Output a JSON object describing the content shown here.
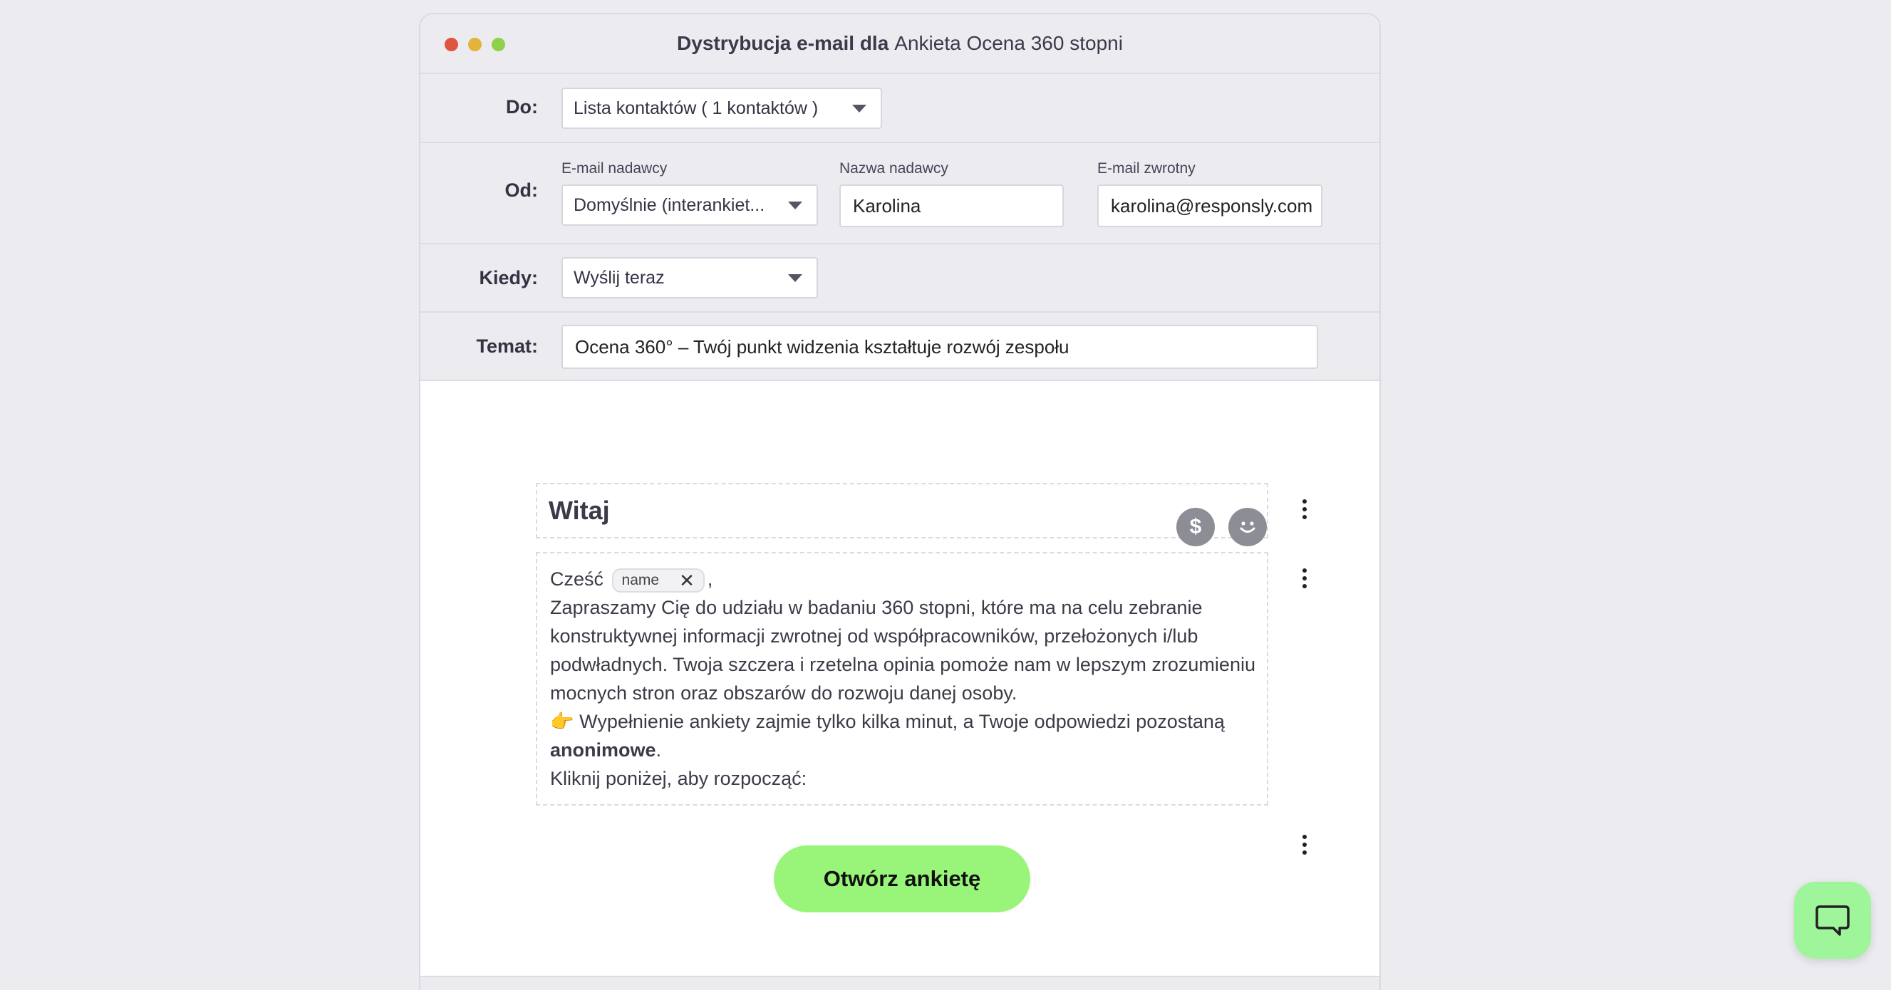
{
  "window": {
    "title_bold": "Dystrybucja e-mail dla",
    "title_survey": "Ankieta Ocena 360 stopni"
  },
  "to": {
    "label": "Do:",
    "select_value": "Lista kontaktów ( 1 kontaktów )"
  },
  "from": {
    "label": "Od:",
    "sender_email_label": "E-mail nadawcy",
    "sender_email_value": "Domyślnie (interankiet...",
    "sender_name_label": "Nazwa nadawcy",
    "sender_name_value": "Karolina",
    "reply_email_label": "E-mail zwrotny",
    "reply_email_value": "karolina@responsly.com"
  },
  "when": {
    "label": "Kiedy:",
    "select_value": "Wyślij teraz"
  },
  "subject": {
    "label": "Temat:",
    "value": "Ocena 360° – Twój punkt widzenia kształtuje rozwój zespołu"
  },
  "email": {
    "heading": "Witaj",
    "dollar_symbol": "$",
    "greeting": "Cześć",
    "name_tag": "name",
    "tag_close": "✕",
    "comma": ",",
    "paragraph1": "Zapraszamy Cię do udziału w badaniu 360 stopni, które ma na celu zebranie konstruktywnej informacji zwrotnej od współpracowników, przełożonych i/lub podwładnych. Twoja szczera i rzetelna opinia pomoże nam w lepszym zrozumieniu mocnych stron oraz obszarów do rozwoju danej osoby.",
    "pointing_emoji": "👉",
    "paragraph2_prefix": "Wypełnienie ankiety zajmie tylko kilka minut, a Twoje odpowiedzi pozostaną",
    "paragraph2_bold": "anonimowe",
    "paragraph2_suffix": ".",
    "paragraph3": "Kliknij poniżej, aby rozpocząć:",
    "cta_label": "Otwórz ankietę"
  },
  "colors": {
    "accent_green": "#98f57a",
    "chat_green": "#9ff59a",
    "background": "#ececf0"
  }
}
